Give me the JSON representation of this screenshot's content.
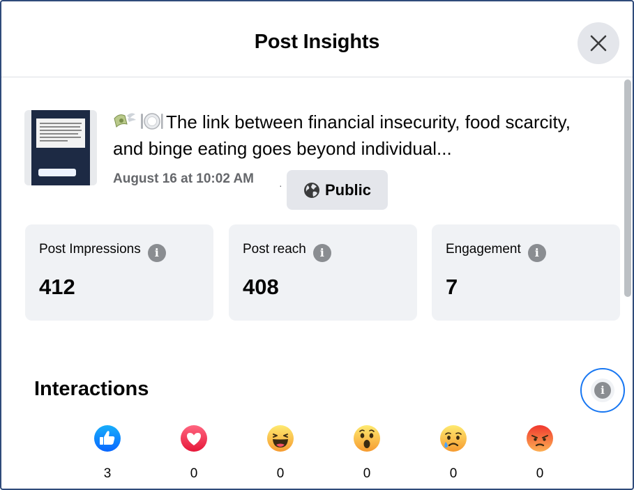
{
  "dialog": {
    "title": "Post Insights"
  },
  "post": {
    "text": "The link between financial insecurity, food scarcity, and binge eating goes beyond individual...",
    "date": "August 16 at 10:02 AM",
    "separator": "·",
    "audience": "Public",
    "emoji_icons": [
      "money-with-wings-icon",
      "plate-icon"
    ]
  },
  "metrics": [
    {
      "label": "Post Impressions",
      "value": "412"
    },
    {
      "label": "Post reach",
      "value": "408"
    },
    {
      "label": "Engagement",
      "value": "7"
    }
  ],
  "interactions": {
    "title": "Interactions",
    "reactions": [
      {
        "name": "like-reaction-icon",
        "count": "3"
      },
      {
        "name": "love-reaction-icon",
        "count": "0"
      },
      {
        "name": "haha-reaction-icon",
        "count": "0"
      },
      {
        "name": "wow-reaction-icon",
        "count": "0"
      },
      {
        "name": "sad-reaction-icon",
        "count": "0"
      },
      {
        "name": "angry-reaction-icon",
        "count": "0"
      }
    ]
  },
  "colors": {
    "accent": "#1877f2",
    "card_bg": "#f0f2f5",
    "secondary_text": "#65676b"
  }
}
